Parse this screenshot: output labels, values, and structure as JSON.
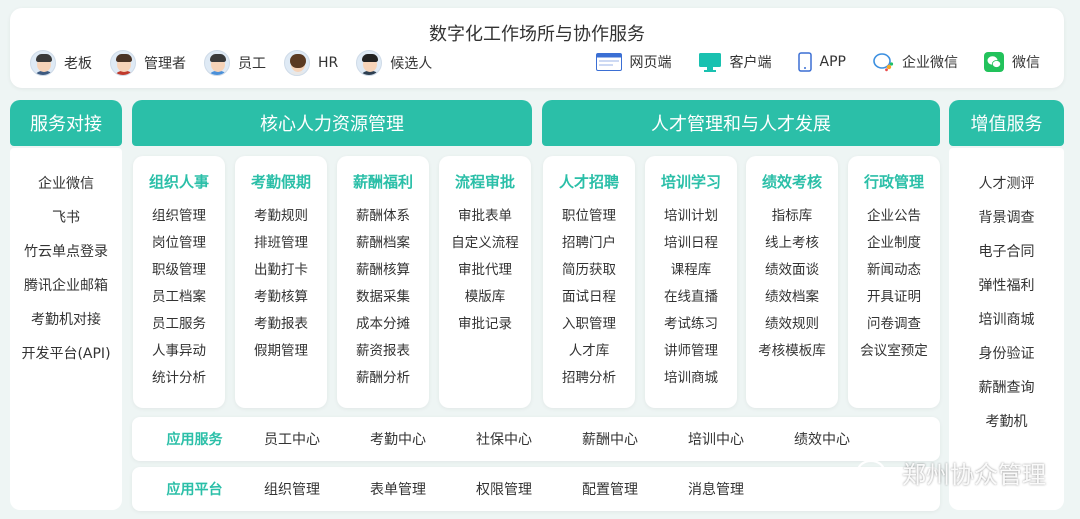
{
  "header": {
    "title": "数字化工作场所与协作服务",
    "roles": [
      {
        "label": "老板",
        "icon": "boss-avatar-icon"
      },
      {
        "label": "管理者",
        "icon": "manager-avatar-icon"
      },
      {
        "label": "员工",
        "icon": "employee-avatar-icon"
      },
      {
        "label": "HR",
        "icon": "hr-avatar-icon"
      },
      {
        "label": "候选人",
        "icon": "candidate-avatar-icon"
      }
    ],
    "platforms": [
      {
        "label": "网页端",
        "icon": "web-browser-icon"
      },
      {
        "label": "客户端",
        "icon": "desktop-monitor-icon"
      },
      {
        "label": "APP",
        "icon": "mobile-phone-icon"
      },
      {
        "label": "企业微信",
        "icon": "wecom-icon"
      },
      {
        "label": "微信",
        "icon": "wechat-icon"
      }
    ]
  },
  "columns": {
    "service_docking": "服务对接",
    "core_hr": "核心人力资源管理",
    "talent": "人才管理和与人才发展",
    "value_added": "增值服务"
  },
  "service_docking_items": [
    "企业微信",
    "飞书",
    "竹云单点登录",
    "腾讯企业邮箱",
    "考勤机对接",
    "开发平台(API)"
  ],
  "value_added_items": [
    "人才测评",
    "背景调查",
    "电子合同",
    "弹性福利",
    "培训商城",
    "身份验证",
    "薪酬查询",
    "考勤机"
  ],
  "modules": [
    {
      "title": "组织人事",
      "items": [
        "组织管理",
        "岗位管理",
        "职级管理",
        "员工档案",
        "员工服务",
        "人事异动",
        "统计分析"
      ]
    },
    {
      "title": "考勤假期",
      "items": [
        "考勤规则",
        "排班管理",
        "出勤打卡",
        "考勤核算",
        "考勤报表",
        "假期管理"
      ]
    },
    {
      "title": "薪酬福利",
      "items": [
        "薪酬体系",
        "薪酬档案",
        "薪酬核算",
        "数据采集",
        "成本分摊",
        "薪资报表",
        "薪酬分析"
      ]
    },
    {
      "title": "流程审批",
      "items": [
        "审批表单",
        "自定义流程",
        "审批代理",
        "模版库",
        "审批记录"
      ]
    },
    {
      "title": "人才招聘",
      "items": [
        "职位管理",
        "招聘门户",
        "简历获取",
        "面试日程",
        "入职管理",
        "人才库",
        "招聘分析"
      ]
    },
    {
      "title": "培训学习",
      "items": [
        "培训计划",
        "培训日程",
        "课程库",
        "在线直播",
        "考试练习",
        "讲师管理",
        "培训商城"
      ]
    },
    {
      "title": "绩效考核",
      "items": [
        "指标库",
        "线上考核",
        "绩效面谈",
        "绩效档案",
        "绩效规则",
        "考核模板库"
      ]
    },
    {
      "title": "行政管理",
      "items": [
        "企业公告",
        "企业制度",
        "新闻动态",
        "开具证明",
        "问卷调查",
        "会议室预定"
      ]
    }
  ],
  "app_services": {
    "label": "应用服务",
    "items": [
      "员工中心",
      "考勤中心",
      "社保中心",
      "薪酬中心",
      "培训中心",
      "绩效中心"
    ]
  },
  "app_platform": {
    "label": "应用平台",
    "items": [
      "组织管理",
      "表单管理",
      "权限管理",
      "配置管理",
      "消息管理"
    ]
  },
  "watermark": "郑州协众管理",
  "colors": {
    "accent": "#2bbfa8",
    "background": "#eef5f4",
    "card": "#ffffff"
  }
}
